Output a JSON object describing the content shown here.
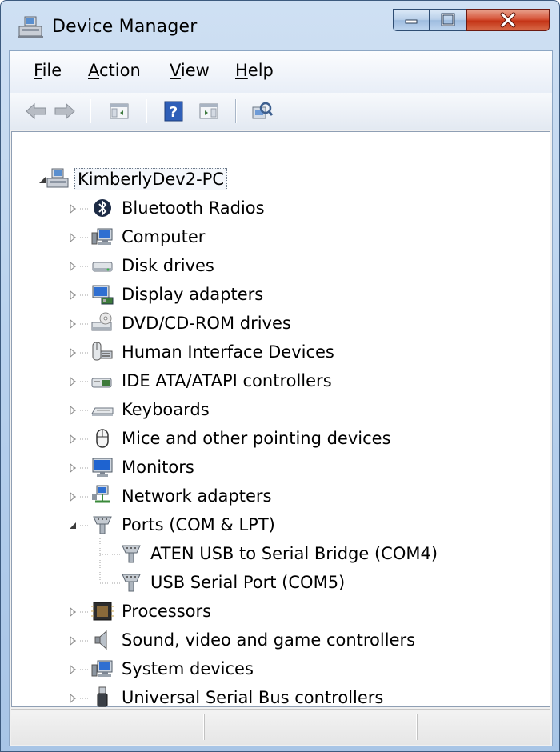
{
  "window": {
    "title": "Device Manager"
  },
  "menu": {
    "items": [
      {
        "label": "File",
        "underline": "F",
        "rest": "ile"
      },
      {
        "label": "Action",
        "underline": "A",
        "rest": "ction"
      },
      {
        "label": "View",
        "underline": "V",
        "rest": "iew"
      },
      {
        "label": "Help",
        "underline": "H",
        "rest": "elp"
      }
    ]
  },
  "toolbar": {
    "buttons": [
      "back-arrow-icon",
      "forward-arrow-icon",
      "show-hide-console-tree-icon",
      "help-icon",
      "properties-icon",
      "scan-hardware-icon"
    ]
  },
  "tree": {
    "root": {
      "label": "KimberlyDev2-PC",
      "expanded": true
    },
    "categories": [
      {
        "label": "Bluetooth Radios",
        "icon": "bluetooth-icon"
      },
      {
        "label": "Computer",
        "icon": "computer-icon"
      },
      {
        "label": "Disk drives",
        "icon": "disk-drive-icon"
      },
      {
        "label": "Display adapters",
        "icon": "display-adapter-icon"
      },
      {
        "label": "DVD/CD-ROM drives",
        "icon": "dvd-drive-icon"
      },
      {
        "label": "Human Interface Devices",
        "icon": "hid-icon"
      },
      {
        "label": "IDE ATA/ATAPI controllers",
        "icon": "ide-controller-icon"
      },
      {
        "label": "Keyboards",
        "icon": "keyboard-icon"
      },
      {
        "label": "Mice and other pointing devices",
        "icon": "mouse-icon"
      },
      {
        "label": "Monitors",
        "icon": "monitor-icon"
      },
      {
        "label": "Network adapters",
        "icon": "network-adapter-icon"
      },
      {
        "label": "Ports (COM & LPT)",
        "icon": "port-icon",
        "expanded": true
      },
      {
        "label": "Processors",
        "icon": "processor-icon"
      },
      {
        "label": "Sound, video and game controllers",
        "icon": "speaker-icon"
      },
      {
        "label": "System devices",
        "icon": "system-device-icon"
      },
      {
        "label": "Universal Serial Bus controllers",
        "icon": "usb-icon"
      }
    ],
    "ports_children": [
      {
        "label": "ATEN USB to Serial Bridge (COM4)",
        "icon": "port-icon"
      },
      {
        "label": "USB Serial Port (COM5)",
        "icon": "port-icon"
      }
    ]
  },
  "colors": {
    "title_bar": "#b9d2ee",
    "close_button": "#c43416",
    "tree_background": "#ffffff"
  }
}
